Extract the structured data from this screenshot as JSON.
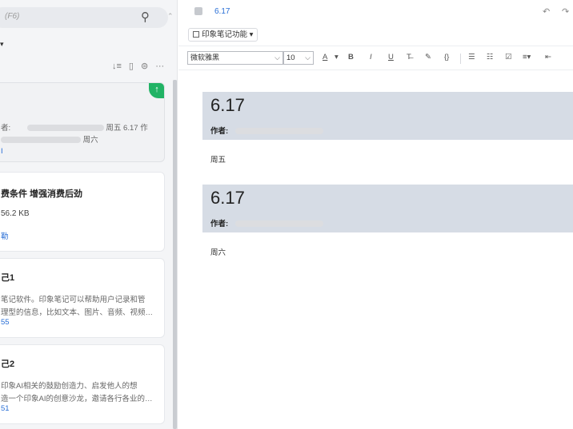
{
  "left": {
    "search_placeholder": "(F6)",
    "cards": [
      {
        "author_prefix": "者:",
        "date_text": "周五 6.17 作",
        "line2_suffix": "周六",
        "link": ""
      },
      {
        "title": "费条件 增强消费后劲",
        "size": "56.2 KB",
        "link": ""
      },
      {
        "title": "己1",
        "line1": "笔记软件。印象笔记可以帮助用户记录和管",
        "line2": "理型的信息，比如文本、图片、音频、视频…",
        "link": "55"
      },
      {
        "title": "己2",
        "line1": "印象AI相关的鼓励创造力、启发他人的想",
        "line2": "造一个印象AI的创意沙龙，邀请各行各业的…",
        "link": "51"
      }
    ]
  },
  "editor": {
    "note_title": "6.17",
    "features_button": "印象笔记功能",
    "font_name": "微软雅黑",
    "font_size": "10",
    "blocks": [
      {
        "heading": "6.17",
        "author_label": "作者:",
        "body": "周五"
      },
      {
        "heading": "6.17",
        "author_label": "作者:",
        "body": "周六"
      }
    ]
  }
}
